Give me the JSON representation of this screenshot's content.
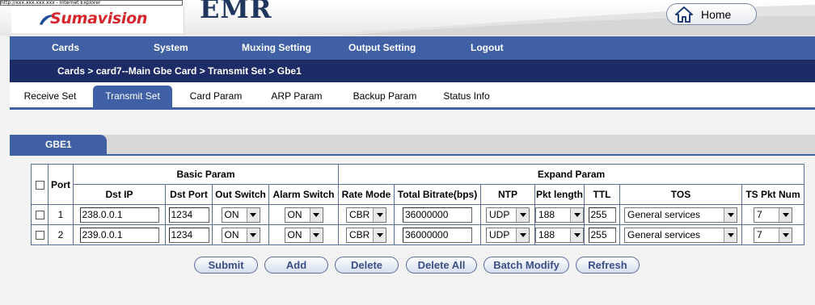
{
  "header": {
    "tooltip": "http://xxx.xxx.xxx.xxx - Internet Explorer",
    "logo_text": "Sumavision",
    "product": "EMR",
    "home_label": "Home"
  },
  "nav": {
    "items": [
      "Cards",
      "System",
      "Muxing Setting",
      "Output Setting",
      "Logout"
    ]
  },
  "breadcrumb": "Cards > card7--Main Gbe Card > Transmit Set > Gbe1",
  "tabs": [
    "Receive Set",
    "Transmit Set",
    "Card Param",
    "ARP Param",
    "Backup Param",
    "Status Info"
  ],
  "active_tab": "Transmit Set",
  "section_tab": "GBE1",
  "table": {
    "groups": [
      "Basic Param",
      "Expand Param"
    ],
    "port_header": "Port",
    "columns": [
      "Dst IP",
      "Dst Port",
      "Out Switch",
      "Alarm Switch",
      "Rate Mode",
      "Total Bitrate(bps)",
      "NTP",
      "Pkt length",
      "TTL",
      "TOS",
      "TS Pkt Num"
    ],
    "rows": [
      {
        "port": "1",
        "dst_ip": "238.0.0.1",
        "dst_port": "1234",
        "out_switch": "ON",
        "alarm_switch": "ON",
        "rate_mode": "CBR",
        "bitrate": "36000000",
        "ntp": "UDP",
        "pkt_length": "188",
        "ttl": "255",
        "tos": "General services",
        "ts_pkt_num": "7"
      },
      {
        "port": "2",
        "dst_ip": "239.0.0.1",
        "dst_port": "1234",
        "out_switch": "ON",
        "alarm_switch": "ON",
        "rate_mode": "CBR",
        "bitrate": "36000000",
        "ntp": "UDP",
        "pkt_length": "188",
        "ttl": "255",
        "tos": "General services",
        "ts_pkt_num": "7"
      }
    ]
  },
  "buttons": [
    "Submit",
    "Add",
    "Delete",
    "Delete All",
    "Batch Modify",
    "Refresh"
  ],
  "colors": {
    "nav_bg": "#3f60a5",
    "breadcrumb_bg": "#1d2b66",
    "logo_red": "#d8262f",
    "product_blue": "#20365f",
    "button_text": "#3a4f85"
  },
  "icons": {
    "home": "home-icon",
    "dropdown": "chevron-down-icon"
  }
}
